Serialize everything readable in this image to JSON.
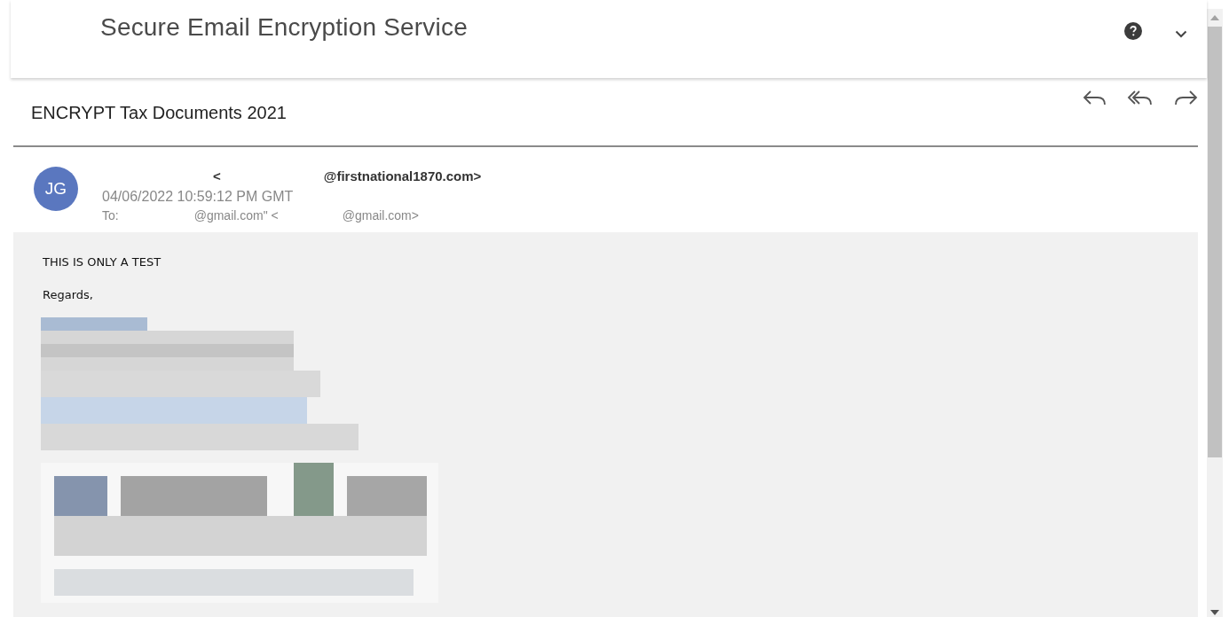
{
  "header": {
    "title": "Secure Email Encryption Service"
  },
  "message": {
    "subject": "ENCRYPT Tax Documents 2021",
    "sender": {
      "initials": "JG",
      "name_part": "<",
      "address_part": "@firstnational1870.com>"
    },
    "date": "04/06/2022 10:59:12 PM GMT",
    "to": {
      "label": "To:",
      "parts": [
        "@gmail.com\" <",
        "@gmail.com>"
      ]
    },
    "body": [
      "THIS IS ONLY A TEST",
      "Regards,"
    ]
  }
}
